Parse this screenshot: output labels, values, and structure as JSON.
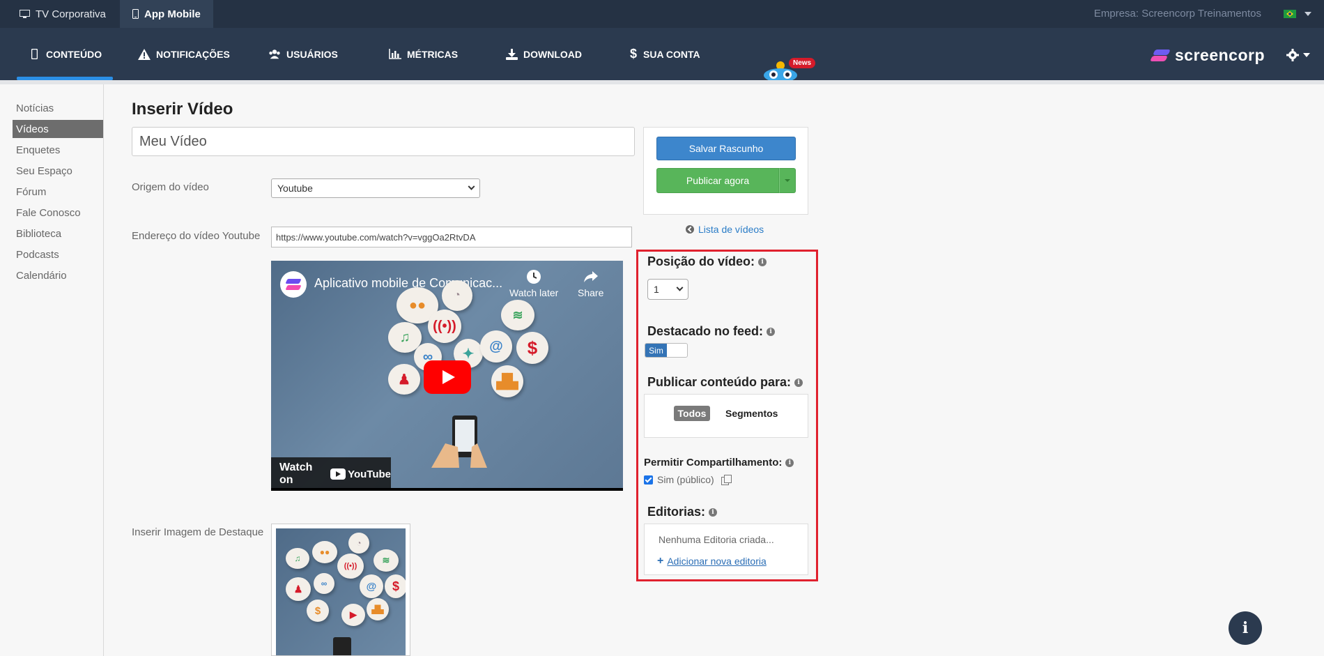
{
  "topbar": {
    "tabs": [
      {
        "label": "TV Corporativa",
        "icon": "monitor-icon"
      },
      {
        "label": "App Mobile",
        "icon": "mobile-icon"
      }
    ],
    "company": "Empresa: Screencorp Treinamentos",
    "flag": "brazil-flag-icon"
  },
  "nav": {
    "items": [
      {
        "label": "CONTEÚDO",
        "icon": "mobile-icon"
      },
      {
        "label": "NOTIFICAÇÕES",
        "icon": "warning-icon"
      },
      {
        "label": "USUÁRIOS",
        "icon": "users-icon"
      },
      {
        "label": "MÉTRICAS",
        "icon": "bar-chart-icon"
      },
      {
        "label": "DOWNLOAD",
        "icon": "download-icon"
      },
      {
        "label": "SUA CONTA",
        "icon": "dollar-icon"
      }
    ],
    "news_badge": "News",
    "logo_text": "screencorp"
  },
  "sidebar": {
    "items": [
      "Notícias",
      "Vídeos",
      "Enquetes",
      "Seu Espaço",
      "Fórum",
      "Fale Conosco",
      "Biblioteca",
      "Podcasts",
      "Calendário"
    ]
  },
  "form": {
    "page_title": "Inserir Vídeo",
    "title_value": "Meu Vídeo",
    "origin_label": "Origem do vídeo",
    "origin_value": "Youtube",
    "url_label": "Endereço do vídeo Youtube",
    "url_value": "https://www.youtube.com/watch?v=vggOa2RtvDA",
    "image_label": "Inserir Imagem de Destaque"
  },
  "video": {
    "title": "Aplicativo mobile de Comunicac...",
    "watch_later": "Watch later",
    "share": "Share",
    "watch_on": "Watch on",
    "youtube": "YouTube"
  },
  "publish": {
    "save_draft": "Salvar Rascunho",
    "publish_now": "Publicar agora",
    "list_link": "Lista de vídeos"
  },
  "settings": {
    "position_label": "Posição do vídeo:",
    "position_value": "1",
    "featured_label": "Destacado no feed:",
    "featured_toggle": "Sim",
    "audience_label": "Publicar conteúdo para:",
    "audience_all": "Todos",
    "audience_segments": "Segmentos",
    "share_label": "Permitir Compartilhamento:",
    "share_option": "Sim (público)",
    "editorials_label": "Editorias:",
    "editorials_empty": "Nenhuma Editoria criada...",
    "editorials_add": "Adicionar nova editoria"
  },
  "colors": {
    "topbar": "#253244",
    "nav": "#2b3a4f",
    "accent_blue": "#3d86cc",
    "accent_green": "#58b55a",
    "highlight_red": "#e0212e"
  }
}
